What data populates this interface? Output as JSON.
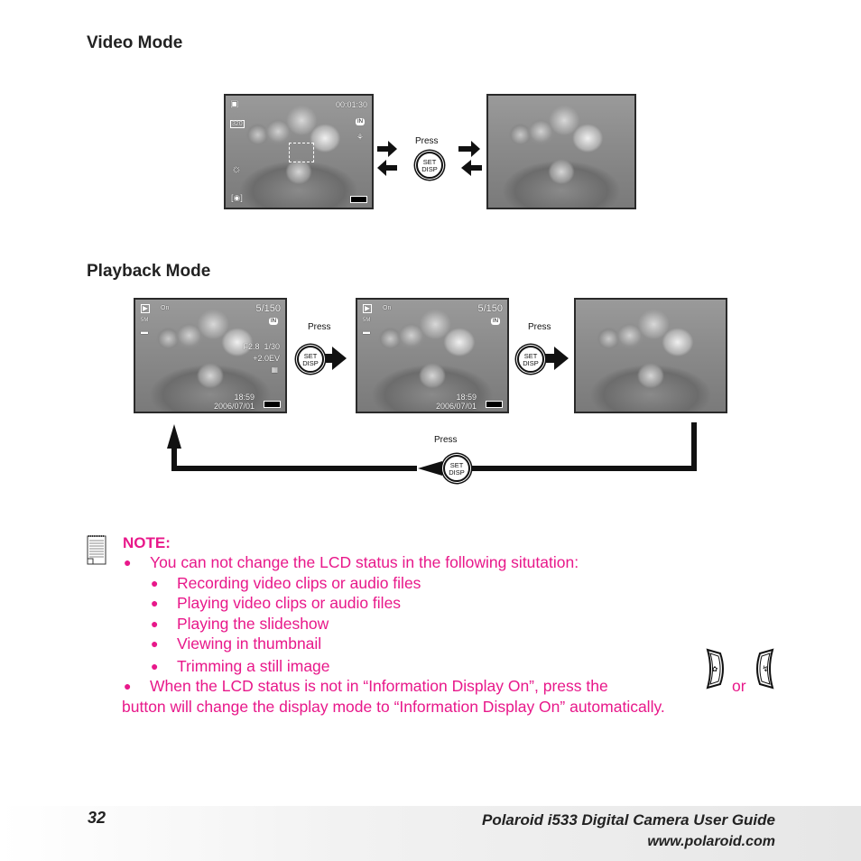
{
  "sections": {
    "video_title": "Video Mode",
    "playback_title": "Playback Mode"
  },
  "video_lcd": {
    "timer": "00:01:30",
    "resolution": "320",
    "storage": "IN"
  },
  "playback_lcd": {
    "counter": "5/150",
    "size": "5M",
    "storage": "IN",
    "aperture_shutter": "F2.8  1/30",
    "flash_ev": "+2.0EV",
    "time": "18:59",
    "date": "2006/07/01",
    "lock": "On"
  },
  "button": {
    "press_label": "Press",
    "set_label": "SET",
    "disp_label": "DISP"
  },
  "note": {
    "title": "NOTE:",
    "intro": "You can not change the LCD status in the following situtation:",
    "items": [
      "Recording video clips or audio files",
      "Playing video clips or audio files",
      "Playing the slideshow",
      "Viewing in thumbnail",
      "Trimming a still image"
    ],
    "line2_a": "When the LCD status is not in “Information Display On”, press the",
    "line2_or": "or",
    "line2_b": "button will change the display mode to “Information Display On” automatically."
  },
  "footer": {
    "page_number": "32",
    "guide_title": "Polaroid i533 Digital Camera User Guide",
    "website": "www.polaroid.com"
  },
  "colors": {
    "note_pink": "#e8188a"
  }
}
